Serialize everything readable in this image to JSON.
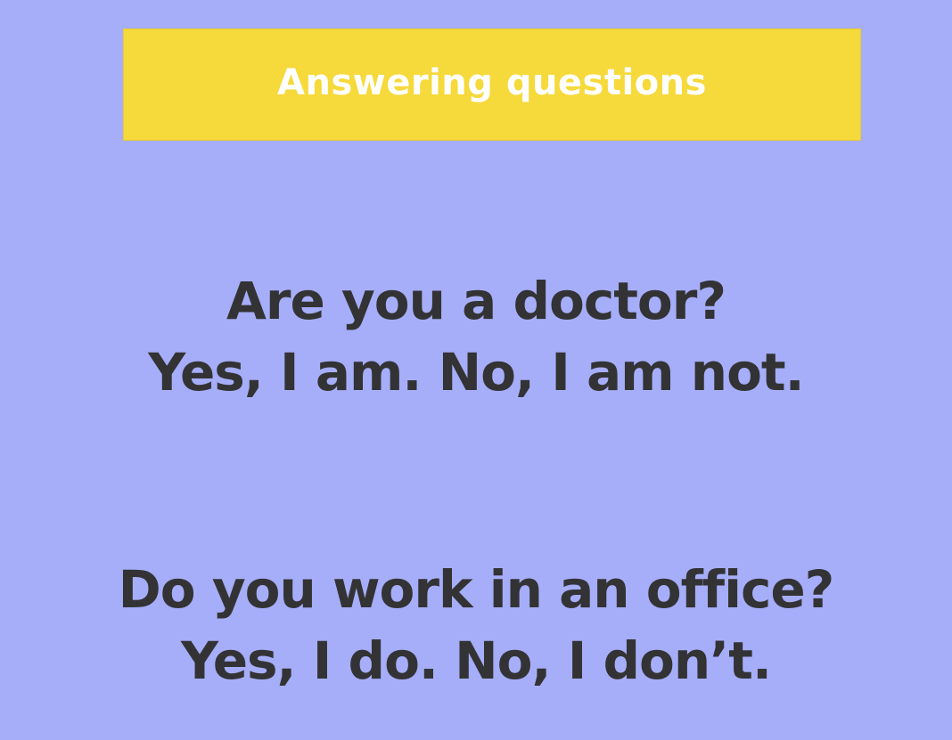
{
  "slide": {
    "title": "Answering questions",
    "qa": [
      {
        "question": "Are you a doctor?",
        "answer": "Yes, I am. No, I am not."
      },
      {
        "question": "Do you work in an office?",
        "answer": "Yes, I do. No, I don’t."
      }
    ]
  },
  "colors": {
    "background": "#a6aef9",
    "banner": "#f6d93a",
    "title_text": "#ffffff",
    "body_text": "#333335"
  }
}
